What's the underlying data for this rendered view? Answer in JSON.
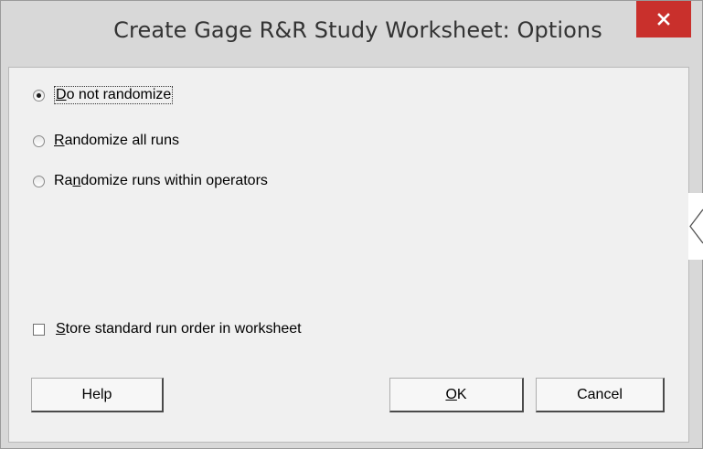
{
  "window": {
    "title": "Create Gage R&R Study Worksheet: Options",
    "close_label": "✕"
  },
  "options": {
    "randomize": [
      {
        "pre": "",
        "u": "D",
        "post": "o not randomize",
        "selected": true
      },
      {
        "pre": "",
        "u": "R",
        "post": "andomize all runs",
        "selected": false
      },
      {
        "pre": "Ra",
        "u": "n",
        "post": "domize runs within operators",
        "selected": false
      }
    ],
    "store_run_order": {
      "pre": "",
      "u": "S",
      "post": "tore standard run order in worksheet",
      "checked": false
    }
  },
  "buttons": {
    "help": "Help",
    "ok_u": "O",
    "ok_post": "K",
    "cancel": "Cancel"
  },
  "colors": {
    "close_bg": "#c9302c",
    "dialog_bg": "#d8d8d8",
    "content_bg": "#f0f0f0"
  },
  "icons": {
    "close": "close-icon",
    "side_tab": "chevron-left-icon"
  }
}
